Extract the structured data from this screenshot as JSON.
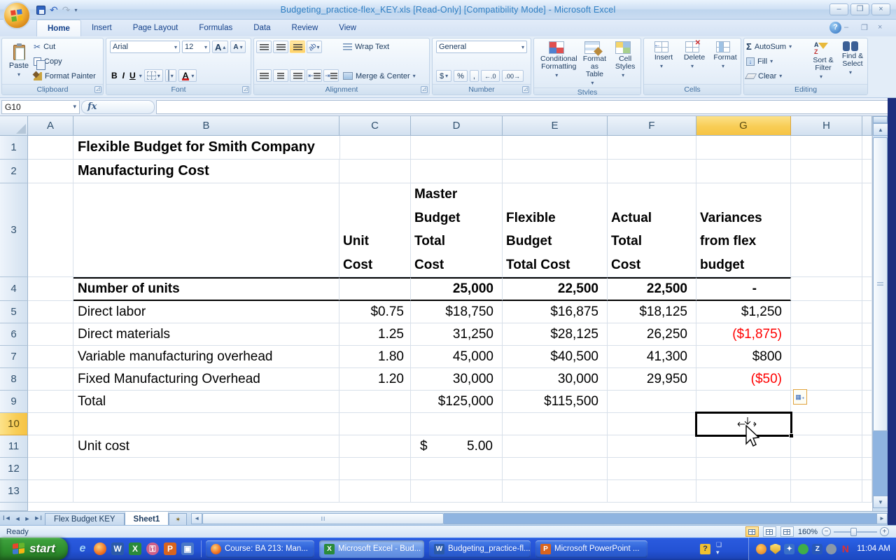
{
  "titlebar": {
    "title": "Budgeting_practice-flex_KEY.xls  [Read-Only]  [Compatibility Mode] -  Microsoft Excel",
    "minimize": "–",
    "restore": "❐",
    "close": "×",
    "undo": "↶",
    "redo": "↷",
    "qat_more": "▾"
  },
  "ribbon": {
    "tabs": [
      {
        "label": "Home"
      },
      {
        "label": "Insert"
      },
      {
        "label": "Page Layout"
      },
      {
        "label": "Formulas"
      },
      {
        "label": "Data"
      },
      {
        "label": "Review"
      },
      {
        "label": "View"
      }
    ],
    "help": "?",
    "clipboard": {
      "label": "Clipboard",
      "paste": "Paste",
      "cut": "Cut",
      "copy": "Copy",
      "format_painter": "Format Painter"
    },
    "font": {
      "label": "Font",
      "name": "Arial",
      "size": "12",
      "grow": "A",
      "shrink": "A",
      "bold": "B",
      "italic": "I",
      "underline": "U"
    },
    "alignment": {
      "label": "Alignment",
      "wrap": "Wrap Text",
      "merge": "Merge & Center"
    },
    "number": {
      "label": "Number",
      "format": "General",
      "currency": "$",
      "percent": "%",
      "comma": ",",
      "inc_dec": "←.0",
      "dec_dec": ".00→"
    },
    "styles": {
      "label": "Styles",
      "conditional": "Conditional Formatting",
      "format_table": "Format as Table",
      "cell_styles": "Cell Styles"
    },
    "cells": {
      "label": "Cells",
      "insert": "Insert",
      "delete": "Delete",
      "format": "Format"
    },
    "editing": {
      "label": "Editing",
      "sigma": "Σ",
      "autosum": "AutoSum",
      "fill": "Fill",
      "clear": "Clear",
      "sort": "Sort & Filter",
      "find": "Find & Select"
    }
  },
  "formula_bar": {
    "name_box": "G10",
    "fx": "fx",
    "formula": ""
  },
  "grid": {
    "columns": [
      "A",
      "B",
      "C",
      "D",
      "E",
      "F",
      "G",
      "H"
    ],
    "row_numbers": [
      "1",
      "2",
      "3",
      "4",
      "5",
      "6",
      "7",
      "8",
      "9",
      "10",
      "11",
      "12",
      "13"
    ],
    "selected_cell": "G10",
    "title1": "Flexible Budget for Smith Company",
    "title2": "Manufacturing Cost",
    "col_headers": {
      "c": "Unit\nCost",
      "d": "Master\nBudget\nTotal\nCost",
      "e": "Flexible\nBudget\nTotal Cost",
      "f": "Actual\nTotal\nCost",
      "g": "Variances\nfrom flex\nbudget"
    },
    "rows": [
      {
        "label": "Number of units",
        "c": "",
        "d": "25,000",
        "e": "22,500",
        "f": "22,500",
        "g": "-"
      },
      {
        "label": "Direct labor",
        "c": "$0.75",
        "d": "$18,750",
        "e": "$16,875",
        "f": "$18,125",
        "g": "$1,250"
      },
      {
        "label": "Direct materials",
        "c": "1.25",
        "d": "31,250",
        "e": "$28,125",
        "f": "26,250",
        "g": "($1,875)"
      },
      {
        "label": "Variable manufacturing overhead",
        "c": "1.80",
        "d": "45,000",
        "e": "$40,500",
        "f": "41,300",
        "g": "$800"
      },
      {
        "label": "Fixed Manufacturing Overhead",
        "c": "1.20",
        "d": "30,000",
        "e": "30,000",
        "f": "29,950",
        "g": "($50)"
      },
      {
        "label": "Total",
        "c": "",
        "d": "$125,000",
        "e": "$115,500",
        "f": "",
        "g": ""
      }
    ],
    "unit_cost": {
      "label": "Unit cost",
      "currency": "$",
      "value": "5.00"
    }
  },
  "sheet_tabs": {
    "tabs": [
      {
        "label": "Flex Budget KEY"
      },
      {
        "label": "Sheet1"
      }
    ],
    "active": "Sheet1"
  },
  "status_bar": {
    "mode": "Ready",
    "zoom": "160%"
  },
  "taskbar": {
    "start_label": "start",
    "windows": [
      {
        "label": "Course: BA 213: Man...",
        "app": "firefox"
      },
      {
        "label": "Microsoft Excel - Bud...",
        "app": "excel"
      },
      {
        "label": "Budgeting_practice-fl...",
        "app": "word"
      },
      {
        "label": "Microsoft PowerPoint ...",
        "app": "powerpoint"
      }
    ],
    "clock": "11:04 AM"
  },
  "colors": {
    "negative": "#ff0000",
    "selection_header": "#f8cd55",
    "taskbar": "#2352d4"
  }
}
